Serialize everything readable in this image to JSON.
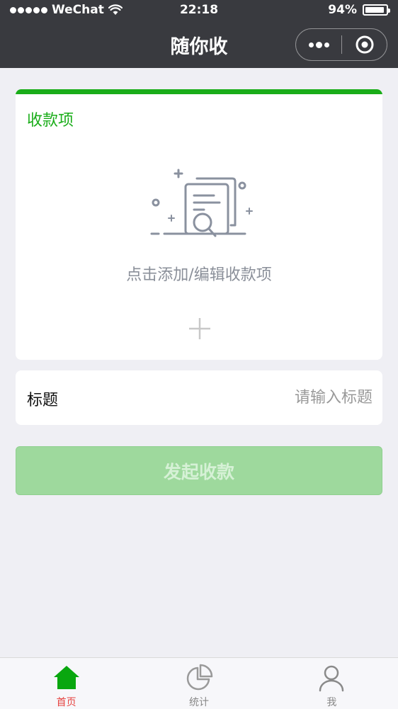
{
  "status_bar": {
    "carrier": "WeChat",
    "time": "22:18",
    "battery_level": "94%",
    "battery_fraction": 0.94
  },
  "nav": {
    "title": "随你收"
  },
  "card": {
    "title": "收款项",
    "empty_hint": "点击添加/编辑收款项"
  },
  "title_row": {
    "label": "标题",
    "value": "",
    "placeholder": "请输入标题"
  },
  "submit": {
    "label": "发起收款"
  },
  "tabbar": {
    "items": [
      {
        "label": "首页",
        "icon": "home-icon",
        "active": true
      },
      {
        "label": "统计",
        "icon": "pie-chart-icon",
        "active": false
      },
      {
        "label": "我",
        "icon": "user-icon",
        "active": false
      }
    ]
  },
  "colors": {
    "brand_green": "#1aad19",
    "submit_disabled": "#9ed99d",
    "header_bg": "#393a3f",
    "active_tab_label": "#e64340"
  }
}
